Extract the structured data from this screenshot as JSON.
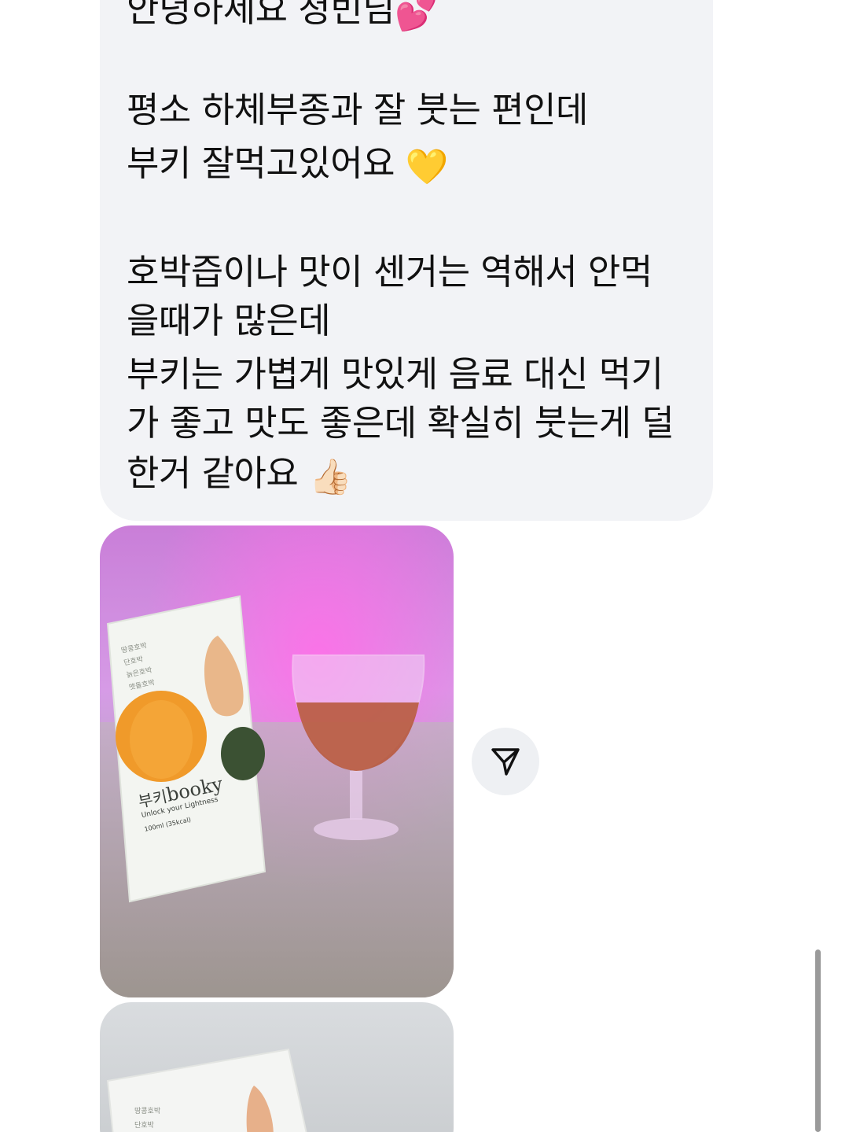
{
  "message": {
    "greeting": "안녕하세요 청빈님",
    "greeting_emoji": "💕",
    "line_1": "평소 하체부종과 잘 붓는 편인데",
    "line_2": "부키 잘먹고있어요",
    "line_2_emoji": "💛",
    "line_3": "호박즙이나 맛이 센거는 역해서 안먹",
    "line_4": "을때가 많은데",
    "line_5": "부키는 가볍게 맛있게 음료 대신 먹기",
    "line_6": "가 좋고 맛도 좋은데 확실히 붓는게 덜",
    "line_7": "한거 같아요",
    "line_7_emoji": "👍🏻"
  },
  "product": {
    "pouch_labels": [
      "땅콩호박",
      "단호박",
      "늙은호박",
      "맷돌호박"
    ],
    "brand_ko": "부키",
    "brand_en": "booky",
    "tagline": "Unlock your Lightness",
    "volume": "100ml (35kcal)"
  },
  "photo_2": {
    "pouch_labels": [
      "땅콩호박",
      "단호박"
    ]
  },
  "icons": {
    "share": "paper-plane-icon"
  },
  "colors": {
    "bubble_bg": "#f2f3f6",
    "text": "#111111",
    "share_bg": "#eef0f3"
  }
}
